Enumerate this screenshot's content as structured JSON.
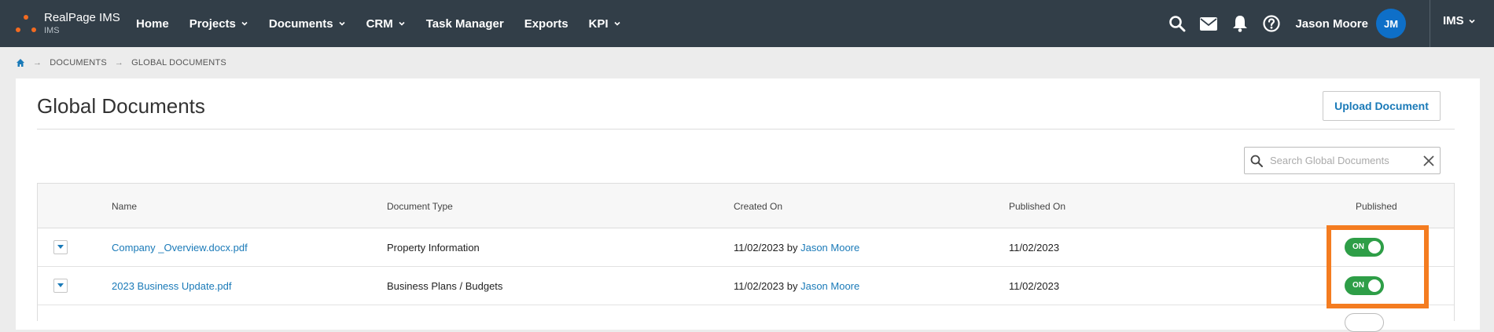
{
  "brand": {
    "name": "RealPage IMS",
    "sub": "IMS",
    "dot_color": "#f36b21"
  },
  "nav": {
    "items": [
      {
        "label": "Home",
        "has_caret": false
      },
      {
        "label": "Projects",
        "has_caret": true
      },
      {
        "label": "Documents",
        "has_caret": true
      },
      {
        "label": "CRM",
        "has_caret": true
      },
      {
        "label": "Task Manager",
        "has_caret": false
      },
      {
        "label": "Exports",
        "has_caret": false
      },
      {
        "label": "KPI",
        "has_caret": true
      }
    ],
    "user_name": "Jason Moore",
    "avatar_initials": "JM",
    "app_switch": "IMS",
    "icons": [
      "search-icon",
      "mail-icon",
      "bell-icon",
      "help-icon"
    ]
  },
  "breadcrumb": [
    "DOCUMENTS",
    "GLOBAL DOCUMENTS"
  ],
  "page": {
    "title": "Global Documents",
    "upload_label": "Upload Document",
    "search_placeholder": "Search Global Documents"
  },
  "table": {
    "headers": {
      "name": "Name",
      "type": "Document Type",
      "created": "Created On",
      "published_on": "Published On",
      "published": "Published"
    },
    "rows": [
      {
        "name": "Company _Overview.docx.pdf",
        "type": "Property Information",
        "created_date": "11/02/2023",
        "created_by_prefix": "by",
        "created_by": "Jason Moore",
        "published_on": "11/02/2023",
        "published_label": "ON"
      },
      {
        "name": "2023 Business Update.pdf",
        "type": "Business Plans / Budgets",
        "created_date": "11/02/2023",
        "created_by_prefix": "by",
        "created_by": "Jason Moore",
        "published_on": "11/02/2023",
        "published_label": "ON"
      }
    ]
  },
  "colors": {
    "nav_bg": "#323e48",
    "accent_link": "#1a7ab8",
    "toggle_on": "#2e9e47",
    "highlight": "#f47c20",
    "avatar_bg": "#0e6fc8"
  }
}
